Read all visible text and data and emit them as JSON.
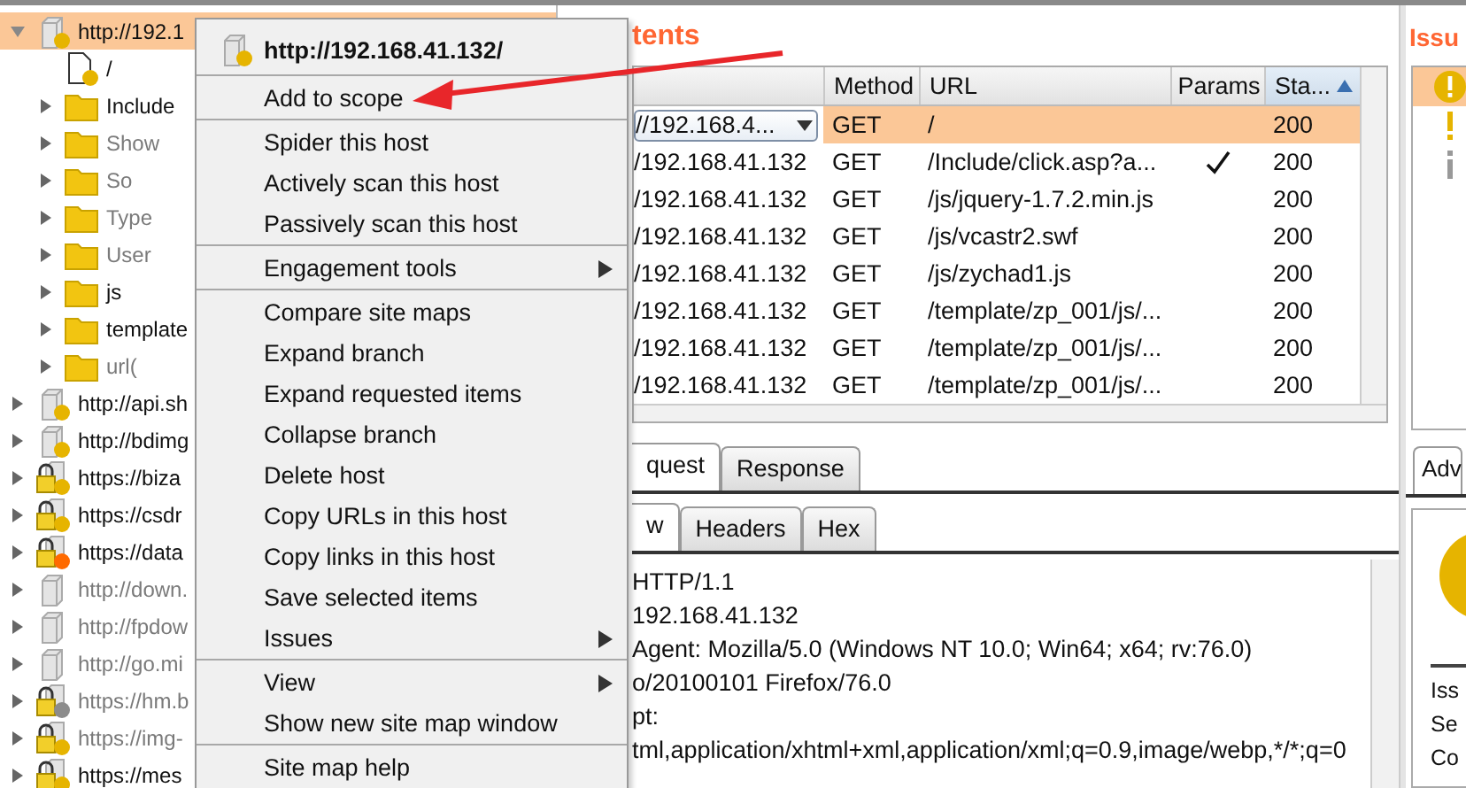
{
  "site_tree": {
    "items": [
      {
        "label": "http://192.1",
        "kind": "host",
        "color": "#e6b400",
        "requested": true,
        "selected": true,
        "expanded": true,
        "children": [
          {
            "label": "/",
            "kind": "file",
            "color": "#e6b400",
            "requested": true,
            "selected": false
          },
          {
            "label": "Include",
            "kind": "folder",
            "requested": true,
            "selected": false,
            "expanded": false
          },
          {
            "label": "Show",
            "kind": "folder",
            "requested": false,
            "selected": false,
            "expanded": false
          },
          {
            "label": "So",
            "kind": "folder",
            "requested": false,
            "selected": false,
            "expanded": false
          },
          {
            "label": "Type",
            "kind": "folder",
            "requested": false,
            "selected": false,
            "expanded": false
          },
          {
            "label": "User",
            "kind": "folder",
            "requested": false,
            "selected": false,
            "expanded": false
          },
          {
            "label": "js",
            "kind": "folder",
            "requested": true,
            "selected": false,
            "expanded": false
          },
          {
            "label": "template",
            "kind": "folder",
            "requested": true,
            "selected": false,
            "expanded": false
          },
          {
            "label": "url(",
            "kind": "folder",
            "requested": false,
            "selected": false,
            "expanded": false
          }
        ]
      },
      {
        "label": "http://api.sh",
        "kind": "host",
        "color": "#e6b400",
        "requested": true,
        "selected": false,
        "expanded": false
      },
      {
        "label": "http://bdimg",
        "kind": "host",
        "color": "#e6b400",
        "requested": true,
        "selected": false,
        "expanded": false
      },
      {
        "label": "https://biza",
        "kind": "secure_host",
        "color": "#e6b400",
        "requested": true,
        "selected": false,
        "expanded": false
      },
      {
        "label": "https://csdr",
        "kind": "secure_host",
        "color": "#e6b400",
        "requested": true,
        "selected": false,
        "expanded": false
      },
      {
        "label": "https://data",
        "kind": "secure_host",
        "color": "#ff6a00",
        "requested": true,
        "selected": false,
        "expanded": false
      },
      {
        "label": "http://down.",
        "kind": "host",
        "requested": false,
        "selected": false,
        "expanded": false
      },
      {
        "label": "http://fpdow",
        "kind": "host",
        "requested": false,
        "selected": false,
        "expanded": false
      },
      {
        "label": "http://go.mi",
        "kind": "host",
        "requested": false,
        "selected": false,
        "expanded": false
      },
      {
        "label": "https://hm.b",
        "kind": "secure_host",
        "color": "#8c8c8c",
        "requested": false,
        "selected": false,
        "expanded": false
      },
      {
        "label": "https://img-",
        "kind": "secure_host",
        "color": "#e6b400",
        "requested": false,
        "selected": false,
        "expanded": false
      },
      {
        "label": "https://mes",
        "kind": "secure_host",
        "color": "#e6b400",
        "requested": true,
        "selected": false,
        "expanded": false
      }
    ]
  },
  "context_menu": {
    "title": "http://192.168.41.132/",
    "groups": [
      [
        {
          "label": "Add to scope",
          "submenu": false
        }
      ],
      [
        {
          "label": "Spider this host",
          "submenu": false
        },
        {
          "label": "Actively scan this host",
          "submenu": false
        },
        {
          "label": "Passively scan this host",
          "submenu": false
        }
      ],
      [
        {
          "label": "Engagement tools",
          "submenu": true
        }
      ],
      [
        {
          "label": "Compare site maps",
          "submenu": false
        },
        {
          "label": "Expand branch",
          "submenu": false
        },
        {
          "label": "Expand requested items",
          "submenu": false
        },
        {
          "label": "Collapse branch",
          "submenu": false
        },
        {
          "label": "Delete host",
          "submenu": false
        },
        {
          "label": "Copy URLs in this host",
          "submenu": false
        },
        {
          "label": "Copy links in this host",
          "submenu": false
        },
        {
          "label": "Save selected items",
          "submenu": false
        },
        {
          "label": "Issues",
          "submenu": true
        }
      ],
      [
        {
          "label": "View",
          "submenu": true
        },
        {
          "label": "Show new site map window",
          "submenu": false
        }
      ],
      [
        {
          "label": "Site map help",
          "submenu": false
        }
      ]
    ]
  },
  "contents": {
    "title": "tents",
    "columns": [
      {
        "label": "Method",
        "sorted": false
      },
      {
        "label": "URL",
        "sorted": false
      },
      {
        "label": "Params",
        "sorted": false
      },
      {
        "label": "Sta...",
        "sorted": true
      }
    ],
    "rows": [
      {
        "column_1": "//192.168.4...",
        "editing": true,
        "method": "GET",
        "url": "/",
        "params": false,
        "status": "200",
        "selected": true
      },
      {
        "column_1": "/192.168.41.132",
        "editing": false,
        "method": "GET",
        "url": "/Include/click.asp?a...",
        "params": true,
        "status": "200",
        "selected": false
      },
      {
        "column_1": "/192.168.41.132",
        "editing": false,
        "method": "GET",
        "url": "/js/jquery-1.7.2.min.js",
        "params": false,
        "status": "200",
        "selected": false
      },
      {
        "column_1": "/192.168.41.132",
        "editing": false,
        "method": "GET",
        "url": "/js/vcastr2.swf",
        "params": false,
        "status": "200",
        "selected": false
      },
      {
        "column_1": "/192.168.41.132",
        "editing": false,
        "method": "GET",
        "url": "/js/zychad1.js",
        "params": false,
        "status": "200",
        "selected": false
      },
      {
        "column_1": "/192.168.41.132",
        "editing": false,
        "method": "GET",
        "url": "/template/zp_001/js/...",
        "params": false,
        "status": "200",
        "selected": false
      },
      {
        "column_1": "/192.168.41.132",
        "editing": false,
        "method": "GET",
        "url": "/template/zp_001/js/...",
        "params": false,
        "status": "200",
        "selected": false
      },
      {
        "column_1": "/192.168.41.132",
        "editing": false,
        "method": "GET",
        "url": "/template/zp_001/js/...",
        "params": false,
        "status": "200",
        "selected": false
      }
    ]
  },
  "message_tabs": [
    {
      "label": "quest",
      "selected": true
    },
    {
      "label": "Response",
      "selected": false
    }
  ],
  "view_tabs": [
    {
      "label": "w",
      "selected": true
    },
    {
      "label": "Headers",
      "selected": false
    },
    {
      "label": "Hex",
      "selected": false
    }
  ],
  "request_lines": [
    " HTTP/1.1",
    "192.168.41.132",
    "Agent: Mozilla/5.0 (Windows NT 10.0; Win64; x64; rv:76.0)",
    "o/20100101 Firefox/76.0",
    "pt:",
    "tml,application/xhtml+xml,application/xml;q=0.9,image/webp,*/*;q=0"
  ],
  "issues": {
    "title": "Issu",
    "items": [
      {
        "kind": "warning",
        "selected": true
      },
      {
        "kind": "warning",
        "selected": false
      },
      {
        "kind": "info",
        "selected": false
      }
    ],
    "tab": {
      "label": "Adv",
      "selected": true
    },
    "detail_lines": [
      "Iss",
      "Se",
      "Co"
    ]
  }
}
